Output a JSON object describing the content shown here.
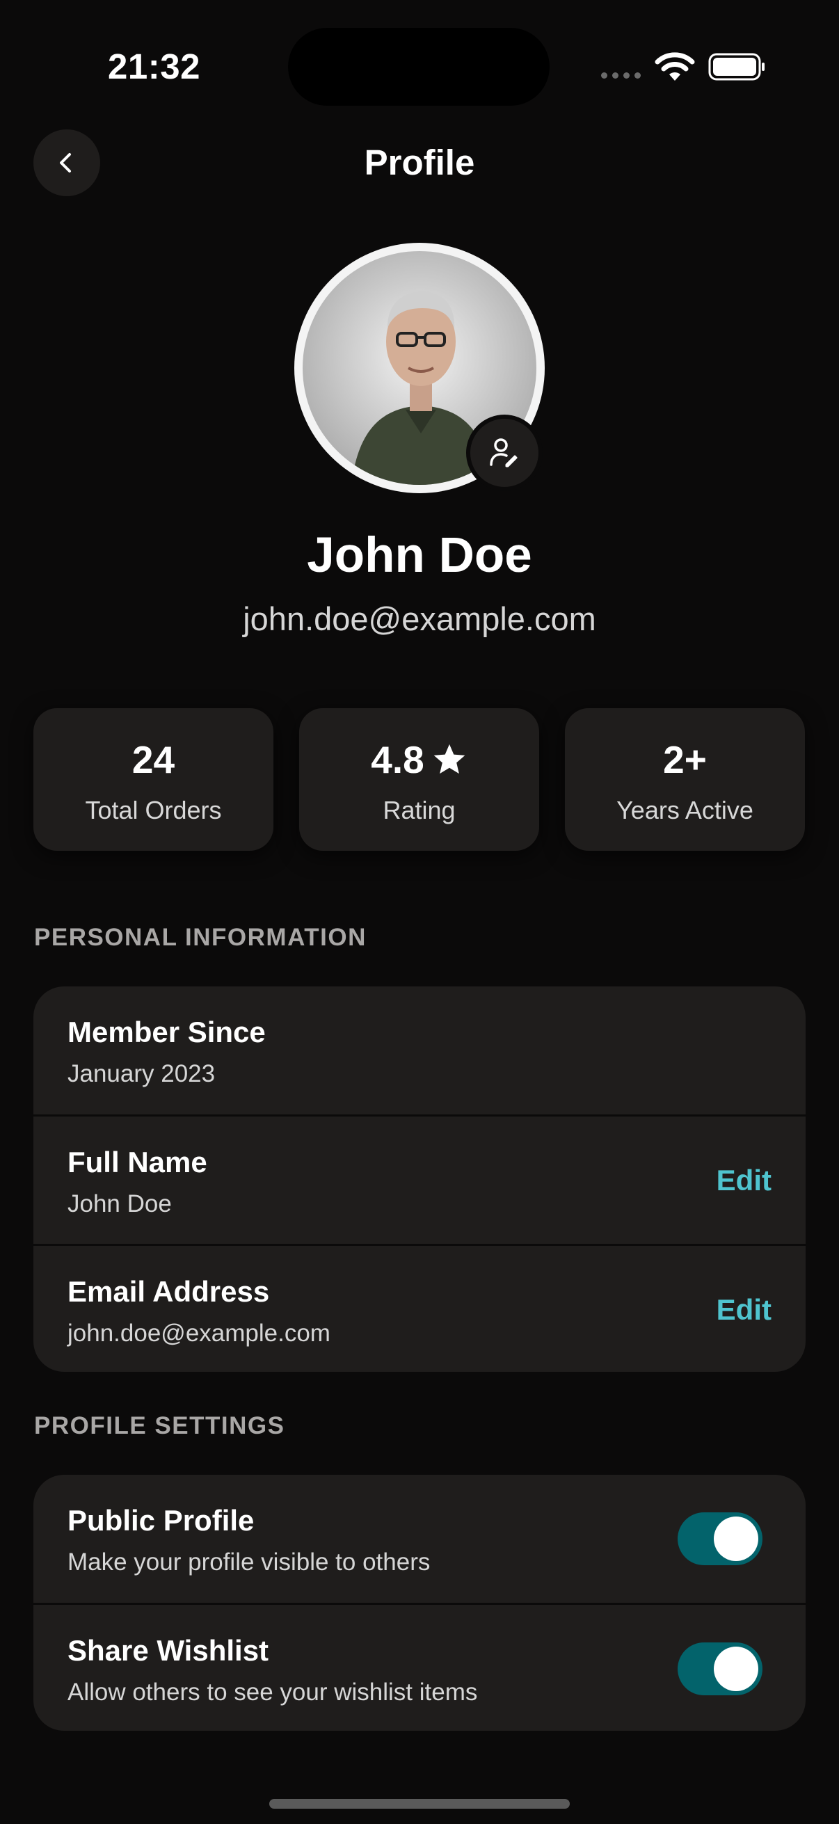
{
  "status_bar": {
    "time": "21:32"
  },
  "header": {
    "title": "Profile",
    "back_icon": "chevron-left-icon"
  },
  "profile": {
    "name": "John Doe",
    "email": "john.doe@example.com",
    "avatar_edit_icon": "user-edit-icon"
  },
  "stats": [
    {
      "value": "24",
      "label": "Total Orders"
    },
    {
      "value": "4.8",
      "label": "Rating",
      "icon": "star-icon"
    },
    {
      "value": "2+",
      "label": "Years Active"
    }
  ],
  "personal_information": {
    "section_title": "PERSONAL INFORMATION",
    "rows": [
      {
        "title": "Member Since",
        "subtitle": "January 2023"
      },
      {
        "title": "Full Name",
        "subtitle": "John Doe",
        "action": "Edit"
      },
      {
        "title": "Email Address",
        "subtitle": "john.doe@example.com",
        "action": "Edit"
      }
    ]
  },
  "profile_settings": {
    "section_title": "PROFILE SETTINGS",
    "rows": [
      {
        "title": "Public Profile",
        "subtitle": "Make your profile visible to others",
        "enabled": true
      },
      {
        "title": "Share Wishlist",
        "subtitle": "Allow others to see your wishlist items",
        "enabled": true
      }
    ]
  },
  "colors": {
    "background": "#0b0a0a",
    "card": "#1f1d1c",
    "accent": "#4fc4cf",
    "toggle_on": "#03636b"
  }
}
